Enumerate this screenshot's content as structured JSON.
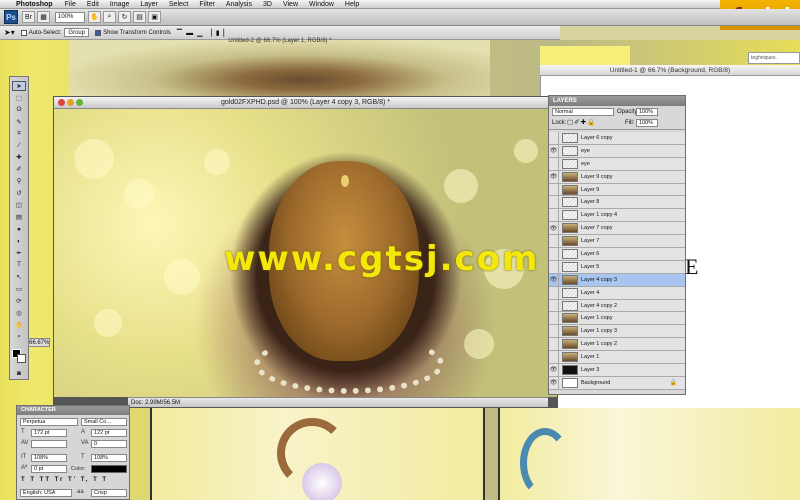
{
  "menubar": {
    "app_name": "Photoshop",
    "items": [
      "File",
      "Edit",
      "Image",
      "Layer",
      "Select",
      "Filter",
      "Analysis",
      "3D",
      "View",
      "Window",
      "Help"
    ]
  },
  "appbar": {
    "zoom": "100%"
  },
  "options": {
    "auto_select_label": "Auto-Select:",
    "auto_select_target": "Group",
    "show_transform_label": "Show Transform Controls"
  },
  "logo": {
    "fx": "fx",
    "phd": "phd"
  },
  "back_doc": {
    "title": "Untitled-2 @ 66.7% (Layer 1, RGB/8) *"
  },
  "right_doc": {
    "title": "Untitled-1 @ 66.7% (Background, RGB/8)",
    "letter": "E",
    "tab_text": "teghniques."
  },
  "main_doc": {
    "title": "gold02FXPHD.psd @ 100% (Layer 4 copy 3, RGB/8) *",
    "watermark": "www.cgtsj.com",
    "status": "Doc: 2.99M/56.5M",
    "zoom_readout": "66.67%"
  },
  "layers_panel": {
    "tab": "LAYERS",
    "blend_mode": "Normal",
    "opacity_label": "Opacity:",
    "opacity": "100%",
    "lock_label": "Lock:",
    "fill_label": "Fill:",
    "fill": "100%",
    "layers": [
      {
        "name": "Layer 6 copy",
        "visible": false,
        "thumb": "trans"
      },
      {
        "name": "eye",
        "visible": true,
        "thumb": "trans"
      },
      {
        "name": "eye",
        "visible": false,
        "thumb": "trans"
      },
      {
        "name": "Layer 9 copy",
        "visible": true,
        "thumb": "img"
      },
      {
        "name": "Layer 9",
        "visible": false,
        "thumb": "img"
      },
      {
        "name": "Layer 8",
        "visible": false,
        "thumb": "trans"
      },
      {
        "name": "Layer 1 copy 4",
        "visible": false,
        "thumb": "trans"
      },
      {
        "name": "Layer 7 copy",
        "visible": true,
        "thumb": "img"
      },
      {
        "name": "Layer 7",
        "visible": false,
        "thumb": "img"
      },
      {
        "name": "Layer 6",
        "visible": false,
        "thumb": "trans"
      },
      {
        "name": "Layer 5",
        "visible": false,
        "thumb": "trans"
      },
      {
        "name": "Layer 4 copy 3",
        "visible": true,
        "thumb": "img",
        "active": true
      },
      {
        "name": "Layer 4",
        "visible": false,
        "thumb": "trans"
      },
      {
        "name": "Layer 4 copy 2",
        "visible": false,
        "thumb": "trans"
      },
      {
        "name": "Layer 1 copy",
        "visible": false,
        "thumb": "img"
      },
      {
        "name": "Layer 1 copy 3",
        "visible": false,
        "thumb": "img"
      },
      {
        "name": "Layer 1 copy 2",
        "visible": false,
        "thumb": "img"
      },
      {
        "name": "Layer 1",
        "visible": false,
        "thumb": "img"
      },
      {
        "name": "Layer 3",
        "visible": true,
        "thumb": "black"
      },
      {
        "name": "Background",
        "visible": true,
        "thumb": "white",
        "locked": true
      }
    ]
  },
  "character_panel": {
    "tab": "CHARACTER",
    "font": "Perpetua",
    "style": "Small Co...",
    "size": "172 pt",
    "leading": "122 pt",
    "tracking": "0",
    "vscale": "108%",
    "hscale": "108%",
    "baseline": "0 pt",
    "color_label": "Color:",
    "language": "English: USA",
    "antialias": "Crisp"
  }
}
